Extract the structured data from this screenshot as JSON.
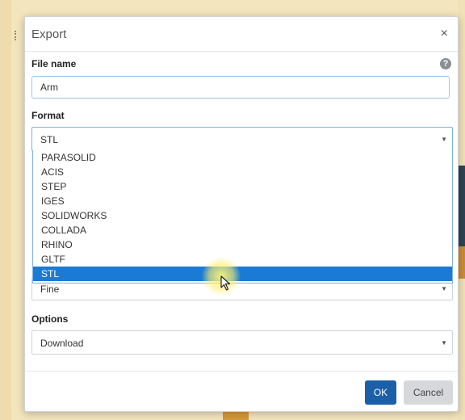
{
  "dialog": {
    "title": "Export",
    "close_glyph": "×",
    "help_glyph": "?",
    "file_name": {
      "label": "File name",
      "value": "Arm"
    },
    "format": {
      "label": "Format",
      "selected": "STL",
      "open": true,
      "options": [
        "PARASOLID",
        "ACIS",
        "STEP",
        "IGES",
        "SOLIDWORKS",
        "COLLADA",
        "RHINO",
        "GLTF",
        "STL"
      ],
      "highlighted_option": "STL"
    },
    "quality": {
      "selected": "Fine"
    },
    "options": {
      "label": "Options",
      "selected": "Download"
    },
    "buttons": {
      "ok": "OK",
      "cancel": "Cancel"
    }
  },
  "icons": {
    "close": "close-icon",
    "help": "help-icon",
    "dropdown_caret": "chevron-down-icon",
    "pointer": "mouse-cursor-icon"
  },
  "colors": {
    "accent": "#1b7ad3",
    "ok_button": "#1b5fa8",
    "cancel_button": "#d6d8db",
    "focus_border": "#7fb2e5"
  }
}
